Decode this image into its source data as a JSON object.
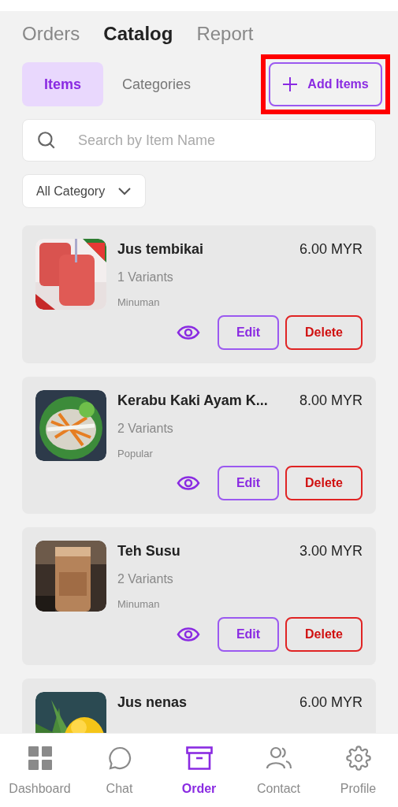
{
  "top_tabs": [
    {
      "label": "Orders",
      "selected": false
    },
    {
      "label": "Catalog",
      "selected": true
    },
    {
      "label": "Report",
      "selected": false
    }
  ],
  "segments": [
    {
      "label": "Items",
      "selected": true
    },
    {
      "label": "Categories",
      "selected": false
    }
  ],
  "add_button": {
    "label": "Add Items",
    "highlighted": true
  },
  "search": {
    "placeholder": "Search by Item Name"
  },
  "category_filter": {
    "value": "All Category"
  },
  "items": [
    {
      "name": "Jus tembikai",
      "price": "6.00 MYR",
      "variants": "1 Variants",
      "category": "Minuman",
      "actions": [
        "Edit",
        "Delete"
      ]
    },
    {
      "name": "Kerabu Kaki Ayam K...",
      "price": "8.00 MYR",
      "variants": "2 Variants",
      "category": "Popular",
      "actions": [
        "Edit",
        "Delete"
      ]
    },
    {
      "name": "Teh Susu",
      "price": "3.00 MYR",
      "variants": "2 Variants",
      "category": "Minuman",
      "actions": [
        "Edit",
        "Delete"
      ]
    },
    {
      "name": "Jus nenas",
      "price": "6.00 MYR"
    }
  ],
  "bottom_nav": [
    {
      "label": "Dashboard",
      "kind": "grid",
      "selected": false
    },
    {
      "label": "Chat",
      "kind": "chat",
      "selected": false
    },
    {
      "label": "Order",
      "kind": "box",
      "selected": true
    },
    {
      "label": "Contact",
      "kind": "people",
      "selected": false
    },
    {
      "label": "Profile",
      "kind": "gear",
      "selected": false
    }
  ]
}
